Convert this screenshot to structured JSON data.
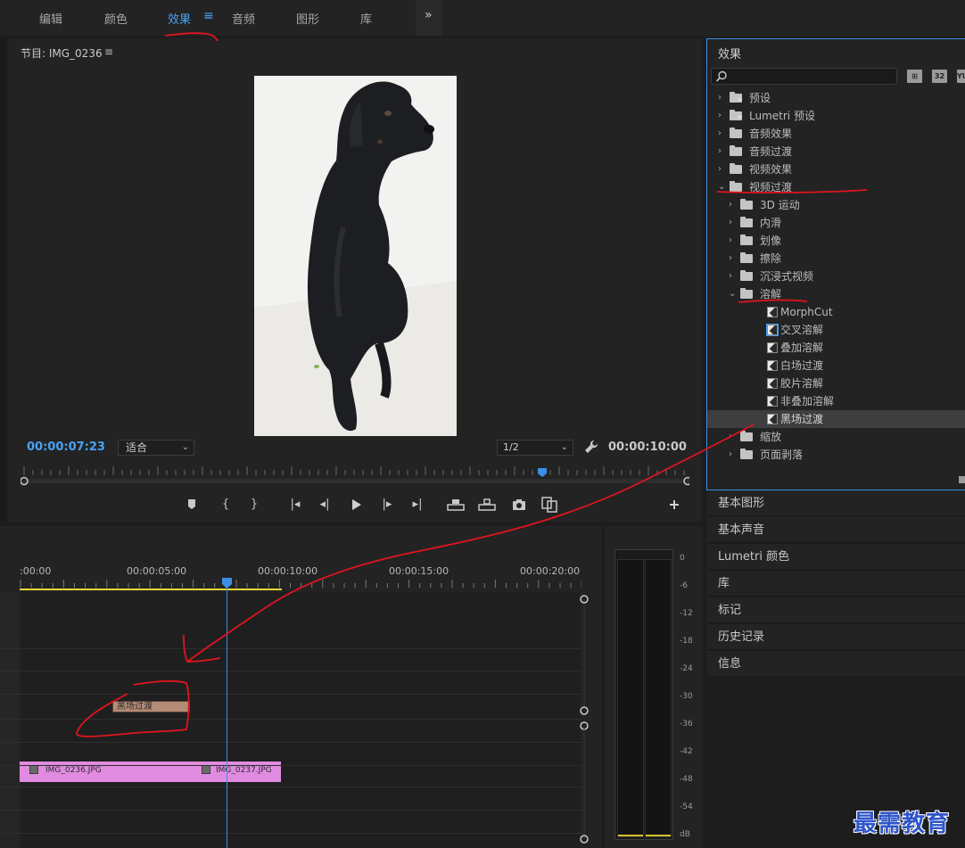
{
  "workspaces": {
    "items": [
      {
        "label": "编辑"
      },
      {
        "label": "颜色"
      },
      {
        "label": "效果",
        "active": true
      },
      {
        "label": "音频"
      },
      {
        "label": "图形"
      },
      {
        "label": "库"
      }
    ],
    "overflow_glyph": "»",
    "menu_glyph": "≡"
  },
  "program_monitor": {
    "title": "节目: IMG_0236",
    "menu_glyph": "≡",
    "timecode_current": "00:00:07:23",
    "timecode_duration": "00:00:10:00",
    "fit_select": "适合",
    "resolution_select": "1/2",
    "transport_icons": [
      "marker-icon",
      "mark-in-icon",
      "mark-out-icon",
      "go-to-in-icon",
      "step-back-icon",
      "play-icon",
      "step-forward-icon",
      "go-to-out-icon",
      "lift-icon",
      "extract-icon",
      "export-frame-icon",
      "comparison-view-icon",
      "add-button-icon"
    ],
    "playhead_fraction": 0.78
  },
  "effects_panel": {
    "title": "效果",
    "search_placeholder": "",
    "filter_buttons": [
      "32",
      "YUV"
    ],
    "tree": [
      {
        "label": "预设",
        "type": "folder-star",
        "depth": 0,
        "expanded": false
      },
      {
        "label": "Lumetri 预设",
        "type": "folder-star",
        "depth": 0,
        "expanded": false
      },
      {
        "label": "音频效果",
        "type": "folder",
        "depth": 0,
        "expanded": false
      },
      {
        "label": "音频过渡",
        "type": "folder",
        "depth": 0,
        "expanded": false
      },
      {
        "label": "视频效果",
        "type": "folder",
        "depth": 0,
        "expanded": false
      },
      {
        "label": "视频过渡",
        "type": "folder",
        "depth": 0,
        "expanded": true
      },
      {
        "label": "3D 运动",
        "type": "folder",
        "depth": 1,
        "expanded": false
      },
      {
        "label": "内滑",
        "type": "folder",
        "depth": 1,
        "expanded": false
      },
      {
        "label": "划像",
        "type": "folder",
        "depth": 1,
        "expanded": false
      },
      {
        "label": "擦除",
        "type": "folder",
        "depth": 1,
        "expanded": false
      },
      {
        "label": "沉浸式视频",
        "type": "folder",
        "depth": 1,
        "expanded": false
      },
      {
        "label": "溶解",
        "type": "folder",
        "depth": 1,
        "expanded": true
      },
      {
        "label": "MorphCut",
        "type": "transition",
        "depth": 2
      },
      {
        "label": "交叉溶解",
        "type": "transition",
        "depth": 2,
        "boxed": true
      },
      {
        "label": "叠加溶解",
        "type": "transition",
        "depth": 2
      },
      {
        "label": "白场过渡",
        "type": "transition",
        "depth": 2
      },
      {
        "label": "胶片溶解",
        "type": "transition",
        "depth": 2
      },
      {
        "label": "非叠加溶解",
        "type": "transition",
        "depth": 2
      },
      {
        "label": "黑场过渡",
        "type": "transition",
        "depth": 2,
        "selected": true
      },
      {
        "label": "缩放",
        "type": "folder",
        "depth": 1,
        "expanded": false
      },
      {
        "label": "页面剥落",
        "type": "folder",
        "depth": 1,
        "expanded": false
      }
    ]
  },
  "side_panels": [
    "基本图形",
    "基本声音",
    "Lumetri 颜色",
    "库",
    "标记",
    "历史记录",
    "信息"
  ],
  "timeline": {
    "ruler_labels": [
      ":00:00",
      "00:00:05:00",
      "00:00:10:00",
      "00:00:15:00",
      "00:00:20:00"
    ],
    "clips": [
      {
        "name": "IMG_0236.JPG"
      },
      {
        "name": "IMG_0237.JPG"
      }
    ],
    "transition_label": "黑场过渡"
  },
  "audio_meter": {
    "db_labels": [
      "0",
      "-6",
      "-12",
      "-18",
      "-24",
      "-30",
      "-36",
      "-42",
      "-48",
      "-54",
      "dB"
    ]
  },
  "watermark": "最需教育",
  "colors": {
    "accent": "#4aa3f5",
    "clip": "#e18be0",
    "transition": "#b48c76",
    "annotation": "#e0141e",
    "panel": "#232323"
  }
}
